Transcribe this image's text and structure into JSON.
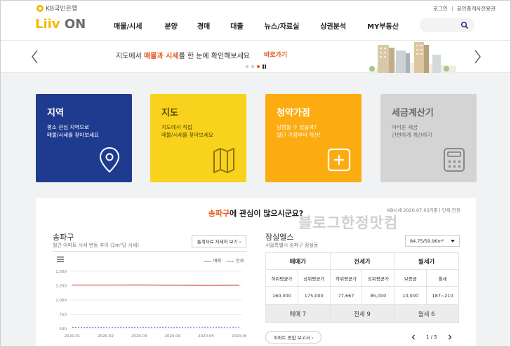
{
  "header": {
    "bank_name": "KB국민은행",
    "logo_liiv": "Liiv",
    "logo_on": "ON",
    "login": "로그인",
    "realtor": "공인중개사전용관",
    "nav": [
      "매물/시세",
      "분양",
      "경매",
      "대출",
      "뉴스/자료실",
      "상권분석",
      "MY부동산"
    ]
  },
  "banner": {
    "text_pre": "지도에서 ",
    "text_hl": "매물과 시세",
    "text_post": "를 한 눈에 확인해보세요",
    "link": "바로가기"
  },
  "cards": [
    {
      "title": "지역",
      "desc": "평소 관심 지역으로\n매물/시세를 찾아보세요"
    },
    {
      "title": "지도",
      "desc": "지도에서 직접\n매물/시세를 찾아보세요"
    },
    {
      "title": "청약가점",
      "desc": "당첨될 수 있을까?\n얼단 기점부터 계산!"
    },
    {
      "title": "세금계산기",
      "desc": "아리운 세금\n간편하게 계산하기"
    }
  ],
  "panel": {
    "title_hl": "송파구",
    "title_rest": "에 관심이 많으시군요?",
    "kb_note": "KB시세 2020.07.03기준 | 단위:만원",
    "watermark": "블로그한정맛컴"
  },
  "left": {
    "region": "송파구",
    "subtitle": "월간 아파트 시세 변동 추이 (1m²당 시세)",
    "stat_button": "통계자료 자세히 보기 ›"
  },
  "chart_data": {
    "type": "line",
    "x": [
      "2020.01",
      "2020.02",
      "2020.03",
      "2020.04",
      "2020.05",
      "2020.06"
    ],
    "series": [
      {
        "name": "매매",
        "values": [
          1260,
          1260,
          1262,
          1258,
          1255,
          1258
        ],
        "color": "#e45a5a"
      },
      {
        "name": "전세",
        "values": [
          520,
          522,
          523,
          523,
          524,
          525
        ],
        "color": "#5a7ac8"
      }
    ],
    "yticks": [
      "1,500",
      "1,250",
      "1,000",
      "750",
      "500"
    ],
    "ylim": [
      500,
      1500
    ]
  },
  "apt": {
    "name": "잠실엘스",
    "address": "서울특별시 송파구 잠실동",
    "area": "84.75/59.96m²",
    "table_headers": [
      "매매가",
      "전세가",
      "월세가"
    ],
    "sub_headers": [
      "하위평균가",
      "상위평균가",
      "하위평균가",
      "상위평균가",
      "보증금",
      "월세"
    ],
    "values": [
      "160,000",
      "175,000",
      "77,667",
      "85,000",
      "10,000",
      "187~210"
    ],
    "counts": [
      "매매 7",
      "전세 9",
      "월세 6"
    ],
    "report_button": "아파트 종합 보고서 ›",
    "page": "1 / 5"
  }
}
